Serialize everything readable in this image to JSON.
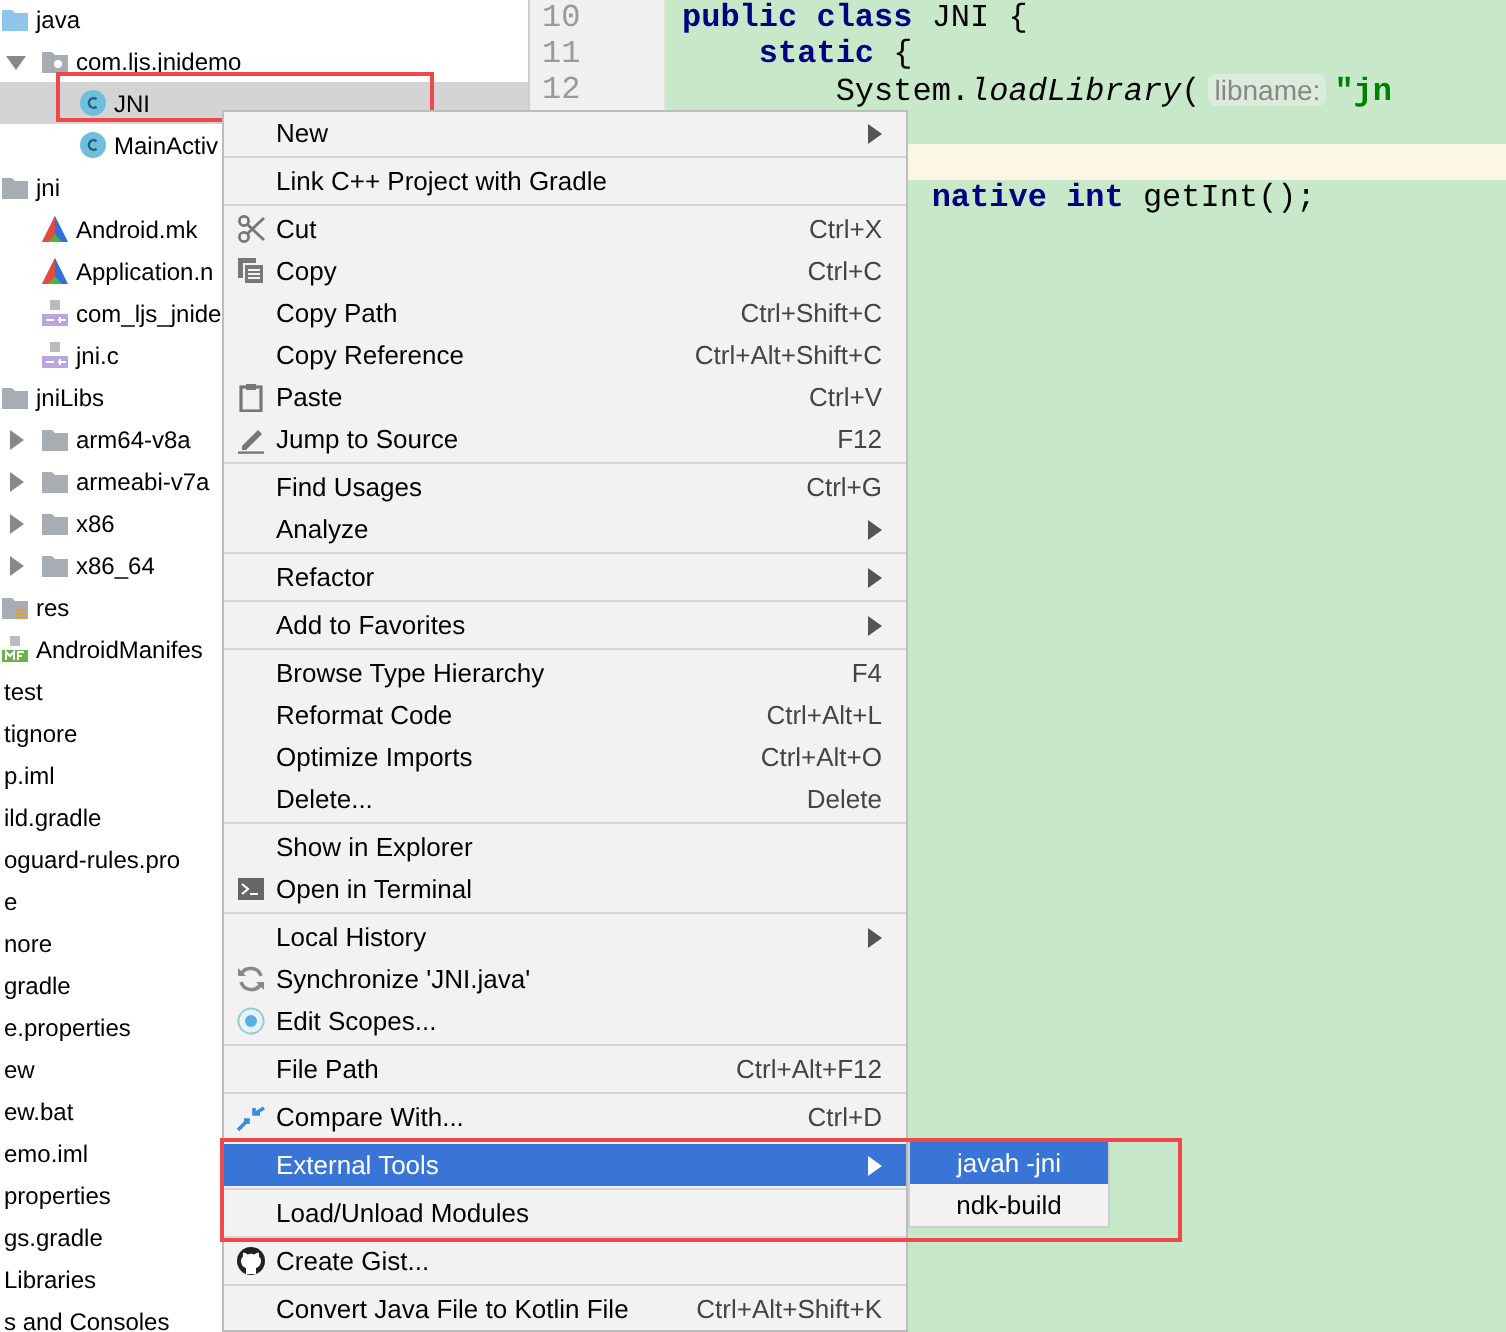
{
  "project_tree": {
    "nested_items": [
      {
        "label": "java",
        "kind": "source-folder",
        "selected": false,
        "children": [
          {
            "label": "com.ljs.jnidemo",
            "kind": "package",
            "selected": false,
            "expanded": true,
            "children": [
              {
                "label": "JNI",
                "kind": "class",
                "selected": true
              },
              {
                "label": "MainActiv",
                "kind": "class",
                "selected": false
              }
            ]
          }
        ]
      },
      {
        "label": "jni",
        "kind": "folder",
        "selected": false,
        "children": [
          {
            "label": "Android.mk",
            "kind": "makefile",
            "selected": false
          },
          {
            "label": "Application.n",
            "kind": "makefile",
            "selected": false
          },
          {
            "label": "com_ljs_jnide",
            "kind": "cpp",
            "selected": false
          },
          {
            "label": "jni.c",
            "kind": "cpp",
            "selected": false
          }
        ]
      },
      {
        "label": "jniLibs",
        "kind": "folder",
        "selected": false,
        "children": [
          {
            "label": "arm64-v8a",
            "kind": "folder",
            "selected": false,
            "expanded": false
          },
          {
            "label": "armeabi-v7a",
            "kind": "folder",
            "selected": false,
            "expanded": false
          },
          {
            "label": "x86",
            "kind": "folder",
            "selected": false,
            "expanded": false
          },
          {
            "label": "x86_64",
            "kind": "folder",
            "selected": false,
            "expanded": false
          }
        ]
      },
      {
        "label": "res",
        "kind": "res-folder",
        "selected": false
      },
      {
        "label": "AndroidManifes",
        "kind": "manifest",
        "selected": false
      }
    ],
    "items": [
      {
        "label": "test",
        "selected": false
      },
      {
        "label": "tignore",
        "selected": false
      },
      {
        "label": "p.iml",
        "selected": false
      },
      {
        "label": "ild.gradle",
        "selected": false
      },
      {
        "label": "oguard-rules.pro",
        "selected": false
      },
      {
        "label": "e",
        "selected": false
      },
      {
        "label": "nore",
        "selected": false
      },
      {
        "label": "gradle",
        "selected": false
      },
      {
        "label": "e.properties",
        "selected": false
      },
      {
        "label": "ew",
        "selected": false
      },
      {
        "label": "ew.bat",
        "selected": false
      },
      {
        "label": "emo.iml",
        "selected": false
      },
      {
        "label": "properties",
        "selected": false
      },
      {
        "label": "gs.gradle",
        "selected": false
      },
      {
        "label": "Libraries",
        "selected": false
      },
      {
        "label": "s and Consoles",
        "selected": false
      }
    ]
  },
  "editor": {
    "lines": [
      {
        "number": "10",
        "current": false,
        "tokens": [
          {
            "text": "public class",
            "kind": "keyword"
          },
          {
            "text": " JNI {",
            "kind": "plain"
          }
        ]
      },
      {
        "number": "11",
        "current": false,
        "tokens": [
          {
            "text": "    static",
            "kind": "keyword"
          },
          {
            "text": " {",
            "kind": "plain"
          }
        ]
      },
      {
        "number": "12",
        "current": false,
        "tokens": [
          {
            "text": "        System.",
            "kind": "plain"
          },
          {
            "text": "loadLibrary",
            "kind": "method"
          },
          {
            "text": "(",
            "kind": "plain"
          },
          {
            "text": "libname:",
            "kind": "hint"
          },
          {
            "text": "\"jn",
            "kind": "string"
          }
        ]
      },
      {
        "current": false
      },
      {
        "current": true
      },
      {
        "current": false,
        "tokens": [
          {
            "text": "             native int",
            "kind": "keyword"
          },
          {
            "text": " getInt();",
            "kind": "plain"
          }
        ]
      }
    ]
  },
  "context_menu": {
    "items": [
      {
        "kind": "item",
        "label": "New",
        "submenu": true,
        "selected": false
      },
      {
        "kind": "separator"
      },
      {
        "kind": "item",
        "label": "Link C++ Project with Gradle",
        "submenu": false,
        "selected": false
      },
      {
        "kind": "separator"
      },
      {
        "kind": "item",
        "label": "Cut",
        "shortcut": "Ctrl+X",
        "submenu": false,
        "selected": false
      },
      {
        "kind": "item",
        "label": "Copy",
        "shortcut": "Ctrl+C",
        "submenu": false,
        "selected": false
      },
      {
        "kind": "item",
        "label": "Copy Path",
        "shortcut": "Ctrl+Shift+C",
        "submenu": false,
        "selected": false
      },
      {
        "kind": "item",
        "label": "Copy Reference",
        "shortcut": "Ctrl+Alt+Shift+C",
        "submenu": false,
        "selected": false
      },
      {
        "kind": "item",
        "label": "Paste",
        "shortcut": "Ctrl+V",
        "submenu": false,
        "selected": false
      },
      {
        "kind": "item",
        "label": "Jump to Source",
        "shortcut": "F12",
        "submenu": false,
        "selected": false
      },
      {
        "kind": "separator"
      },
      {
        "kind": "item",
        "label": "Find Usages",
        "shortcut": "Ctrl+G",
        "submenu": false,
        "selected": false
      },
      {
        "kind": "item",
        "label": "Analyze",
        "submenu": true,
        "selected": false
      },
      {
        "kind": "separator"
      },
      {
        "kind": "item",
        "label": "Refactor",
        "submenu": true,
        "selected": false
      },
      {
        "kind": "separator"
      },
      {
        "kind": "item",
        "label": "Add to Favorites",
        "submenu": true,
        "selected": false
      },
      {
        "kind": "separator"
      },
      {
        "kind": "item",
        "label": "Browse Type Hierarchy",
        "shortcut": "F4",
        "submenu": false,
        "selected": false
      },
      {
        "kind": "item",
        "label": "Reformat Code",
        "shortcut": "Ctrl+Alt+L",
        "submenu": false,
        "selected": false
      },
      {
        "kind": "item",
        "label": "Optimize Imports",
        "shortcut": "Ctrl+Alt+O",
        "submenu": false,
        "selected": false
      },
      {
        "kind": "item",
        "label": "Delete...",
        "shortcut": "Delete",
        "submenu": false,
        "selected": false
      },
      {
        "kind": "separator"
      },
      {
        "kind": "item",
        "label": "Show in Explorer",
        "submenu": false,
        "selected": false
      },
      {
        "kind": "item",
        "label": "Open in Terminal",
        "submenu": false,
        "selected": false
      },
      {
        "kind": "separator"
      },
      {
        "kind": "item",
        "label": "Local History",
        "submenu": true,
        "selected": false
      },
      {
        "kind": "item",
        "label": "Synchronize 'JNI.java'",
        "submenu": false,
        "selected": false
      },
      {
        "kind": "item",
        "label": "Edit Scopes...",
        "submenu": false,
        "selected": false
      },
      {
        "kind": "separator"
      },
      {
        "kind": "item",
        "label": "File Path",
        "shortcut": "Ctrl+Alt+F12",
        "submenu": false,
        "selected": false
      },
      {
        "kind": "separator"
      },
      {
        "kind": "item",
        "label": "Compare With...",
        "shortcut": "Ctrl+D",
        "submenu": false,
        "selected": false
      },
      {
        "kind": "separator"
      },
      {
        "kind": "item",
        "label": "External Tools",
        "submenu": true,
        "selected": true
      },
      {
        "kind": "separator"
      },
      {
        "kind": "item",
        "label": "Load/Unload Modules",
        "submenu": false,
        "selected": false
      },
      {
        "kind": "separator"
      },
      {
        "kind": "item",
        "label": "Create Gist...",
        "submenu": false,
        "selected": false
      },
      {
        "kind": "separator"
      },
      {
        "kind": "item",
        "label": "Convert Java File to Kotlin File",
        "shortcut": "Ctrl+Alt+Shift+K",
        "submenu": false,
        "selected": false
      }
    ]
  },
  "submenu": {
    "items": [
      {
        "label": "javah -jni",
        "selected": true
      },
      {
        "label": "ndk-build",
        "selected": false
      }
    ]
  }
}
